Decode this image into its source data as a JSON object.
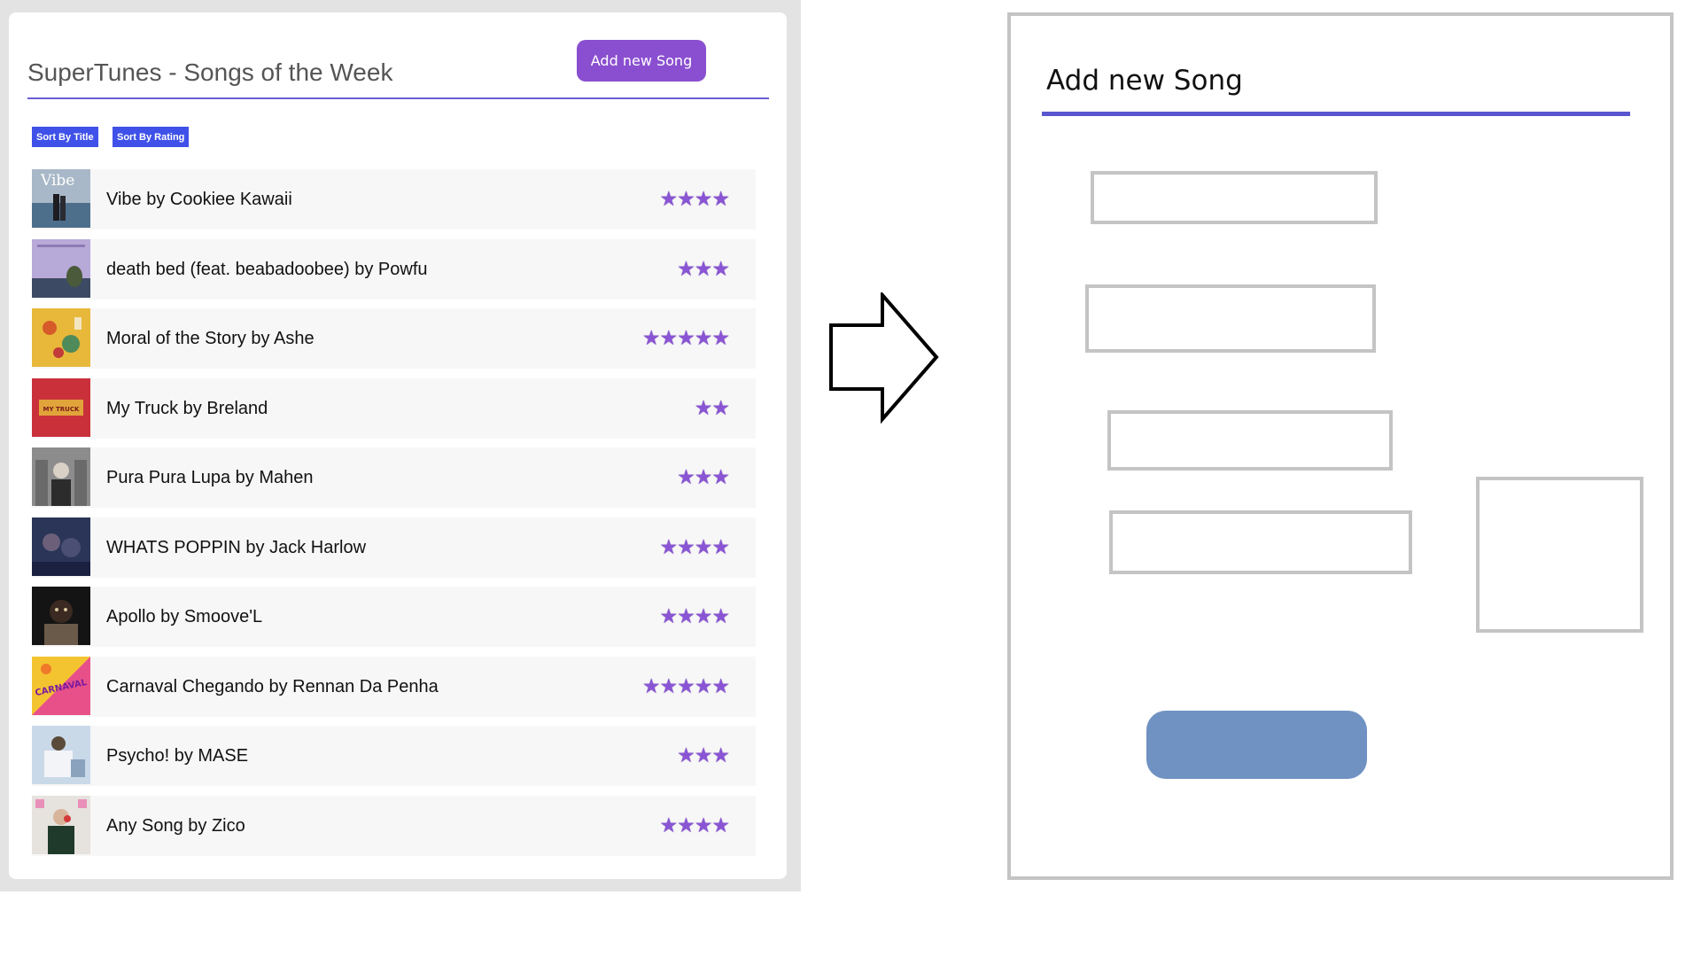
{
  "app": {
    "title": "SuperTunes - Songs of the Week",
    "add_button_label": "Add new Song",
    "sort_by_title_label": "Sort By Title",
    "sort_by_rating_label": "Sort By Rating"
  },
  "songs": [
    {
      "title": "Vibe by Cookiee Kawaii",
      "rating": 4,
      "stars": "★★★★",
      "cover_text": "Vibe"
    },
    {
      "title": "death bed (feat. beabadoobee) by Powfu",
      "rating": 3,
      "stars": "★★★"
    },
    {
      "title": "Moral of the Story by Ashe",
      "rating": 5,
      "stars": "★★★★★"
    },
    {
      "title": "My Truck by Breland",
      "rating": 2,
      "stars": "★★",
      "cover_text": "MY TRUCK"
    },
    {
      "title": "Pura Pura Lupa by Mahen",
      "rating": 3,
      "stars": "★★★"
    },
    {
      "title": "WHATS POPPIN by Jack Harlow",
      "rating": 4,
      "stars": "★★★★"
    },
    {
      "title": "Apollo by Smoove'L",
      "rating": 4,
      "stars": "★★★★"
    },
    {
      "title": "Carnaval Chegando by Rennan Da Penha",
      "rating": 5,
      "stars": "★★★★★",
      "cover_text": "CARNAVAL"
    },
    {
      "title": "Psycho! by MASE",
      "rating": 3,
      "stars": "★★★"
    },
    {
      "title": "Any Song by Zico",
      "rating": 4,
      "stars": "★★★★"
    }
  ],
  "mockup": {
    "title": "Add new Song"
  },
  "colors": {
    "accent_purple": "#8a4fd0",
    "sort_button_blue": "#3f51e8",
    "star_purple": "#8a55d4",
    "mock_submit_blue": "#6f92c2"
  }
}
